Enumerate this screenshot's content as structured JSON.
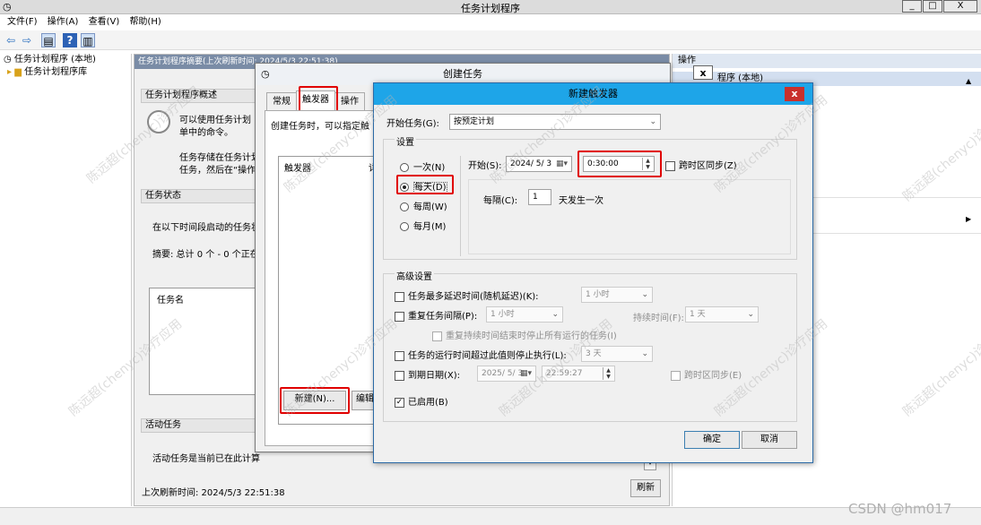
{
  "app": {
    "title": "任务计划程序",
    "min": "_",
    "max": "□",
    "close": "X"
  },
  "menu": [
    "文件(F)",
    "操作(A)",
    "查看(V)",
    "帮助(H)"
  ],
  "tree": {
    "root": "任务计划程序 (本地)",
    "child": "任务计划程序库"
  },
  "center": {
    "header": "任务计划程序摘要(上次刷新时间: 2024/5/3 22:51:38)",
    "overview_title": "任务计划程序概述",
    "overview_text1": "可以使用任务计划",
    "overview_text2": "单中的命令。",
    "overview_text3": "任务存储在任务计划",
    "overview_text4": "任务，然后在“操作",
    "status_title": "任务状态",
    "status_text": "在以下时间段启动的任务状",
    "summary": "摘要: 总计 0 个 - 0 个正在",
    "taskname_col": "任务名",
    "active_title": "活动任务",
    "active_text": "活动任务是当前已在此计算",
    "last_refresh": "上次刷新时间: 2024/5/3 22:51:38",
    "refresh_btn": "刷新"
  },
  "rightpane": {
    "title": "操作",
    "item": "程序 (本地)"
  },
  "create_task": {
    "title": "创建任务",
    "close": "x",
    "tabs": [
      "常规",
      "触发器",
      "操作"
    ],
    "desc": "创建任务时，可以指定触",
    "col_trigger": "触发器",
    "col_detail": "详",
    "new_btn": "新建(N)...",
    "edit_btn": "编辑("
  },
  "new_trigger": {
    "title": "新建触发器",
    "close": "x",
    "begin_label": "开始任务(G):",
    "begin_value": "按预定计划",
    "settings_label": "设置",
    "freq": [
      "一次(N)",
      "每天(D)",
      "每周(W)",
      "每月(M)"
    ],
    "selected_freq": 1,
    "start_label": "开始(S):",
    "start_date": "2024/ 5/ 3",
    "start_time": "0:30:00",
    "sync_tz": "跨时区同步(Z)",
    "interval_label": "每隔(C):",
    "interval_value": "1",
    "interval_unit": "天发生一次",
    "advanced_label": "高级设置",
    "delay_label": "任务最多延迟时间(随机延迟)(K):",
    "delay_value": "1 小时",
    "repeat_label": "重复任务间隔(P):",
    "repeat_value": "1 小时",
    "duration_label": "持续时间(F):",
    "duration_value": "1 天",
    "stop_repeat_label": "重复持续时间结束时停止所有运行的任务(I)",
    "stop_long_label": "任务的运行时间超过此值则停止执行(L):",
    "stop_long_value": "3 天",
    "expire_label": "到期日期(X):",
    "expire_date": "2025/ 5/ 3",
    "expire_time": "22:59:27",
    "expire_sync": "跨时区同步(E)",
    "enabled_label": "已启用(B)",
    "ok": "确定",
    "cancel": "取消"
  },
  "watermark": "陈远超(chenyc)诊疗应用",
  "csdn": "CSDN @hm017",
  "colors": {
    "dialog_title": "#1ea5e8",
    "highlight": "#e00000",
    "close": "#c9302c"
  }
}
